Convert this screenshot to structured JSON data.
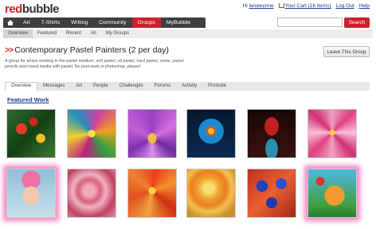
{
  "header": {
    "logo_red": "red",
    "logo_dark": "bubble",
    "greeting": "Hi",
    "username": "lanawynne",
    "cart": "Your Cart (16 items)",
    "logout": "Log Out",
    "help": "Help"
  },
  "mainnav": {
    "items": [
      "Art",
      "T-Shirts",
      "Writing",
      "Community",
      "Groups",
      "MyBubble"
    ],
    "active": "Groups"
  },
  "search": {
    "placeholder": "",
    "button": "Search"
  },
  "subnav": {
    "items": [
      "Overview",
      "Featured",
      "Recent",
      "All",
      "My Groups"
    ]
  },
  "group": {
    "arrows": ">>",
    "title": "Contemporary Pastel Painters (2 per day)",
    "leave": "Leave This Group",
    "description": "A group for artists working in the pastel medium, soft pastel, oil pastel, hard pastel, conte, pastel pencils and mixed media with pastel. No post-work in photoshop, please!"
  },
  "tabs": {
    "items": [
      "Overview",
      "Messages",
      "Art",
      "People",
      "Challenges",
      "Forums",
      "Activity",
      "Promote"
    ]
  },
  "featured": {
    "heading": "Featured Work"
  },
  "colors": {
    "brand": "#cc2229",
    "nav": "#3e3e3e",
    "link": "#1a3d8a"
  }
}
